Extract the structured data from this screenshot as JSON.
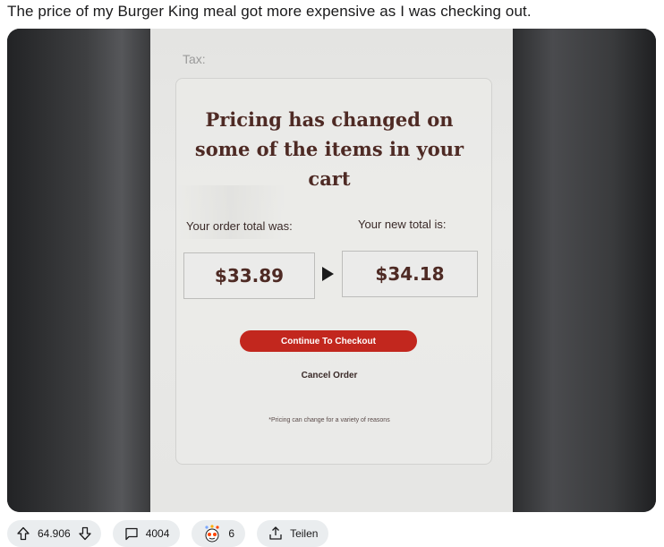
{
  "post": {
    "title": "The price of my Burger King meal got more expensive as I was checking out."
  },
  "kiosk": {
    "tax_label": "Tax:",
    "headline_line1": "Pricing has changed on",
    "headline_line2": "some of the items in your",
    "headline_line3": "cart",
    "old_total_label": "Your order total was:",
    "new_total_label": "Your new total is:",
    "old_total": "$33.89",
    "new_total": "$34.18",
    "checkout_button": "Continue To Checkout",
    "cancel_link": "Cancel Order",
    "footnote": "*Pricing can change for a variety of reasons",
    "accent_color": "#c2271e",
    "text_color": "#4e2a24"
  },
  "actions": {
    "vote_count": "64.906",
    "comment_count": "4004",
    "award_count": "6",
    "share_label": "Teilen",
    "upvote_icon": "arrow-up-icon",
    "downvote_icon": "arrow-down-icon",
    "comment_icon": "comment-bubble-icon",
    "award_icon": "award-icon",
    "share_icon": "share-icon"
  }
}
